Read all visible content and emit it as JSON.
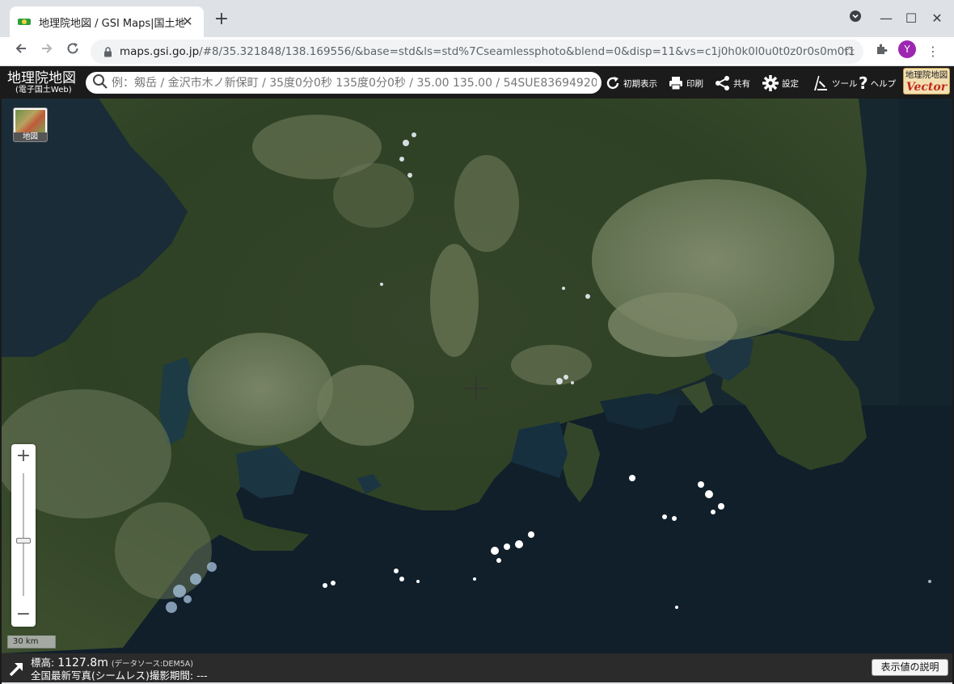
{
  "browser": {
    "tab_title": "地理院地図 / GSI Maps|国土地理院",
    "url_host": "maps.gsi.go.jp",
    "url_path": "/#8/35.321848/138.169556/&base=std&ls=std%7Cseamlessphoto&blend=0&disp=11&vs=c1j0h0k0l0u0t0z0r0s0m0f1",
    "avatar_letter": "Y"
  },
  "header": {
    "logo_main": "地理院地図",
    "logo_sub": "(電子国土Web)",
    "search_placeholder": "例：剱岳 / 金沢市木ノ新保町 / 35度0分0秒 135度0分0秒 / 35.00 135.00 / 54SUE83694920",
    "tools": [
      {
        "icon": "reload-icon",
        "label": "初期表示"
      },
      {
        "icon": "print-icon",
        "label": "印刷"
      },
      {
        "icon": "share-icon",
        "label": "共有"
      },
      {
        "icon": "gear-icon",
        "label": "設定"
      },
      {
        "icon": "tools-icon",
        "label": "ツール"
      },
      {
        "icon": "help-icon",
        "label": "ヘルプ"
      }
    ],
    "vector_badge_top": "地理院地図",
    "vector_badge_bottom": "Vector"
  },
  "map": {
    "layer_button_label": "地図",
    "scale_label": "30 km",
    "zoom_plus": "+",
    "zoom_minus": "−",
    "zoom_level": 8
  },
  "info": {
    "elevation_label": "標高:",
    "elevation_value": "1127.8m",
    "elevation_source": "(データソース:DEM5A)",
    "photo_line": "全国最新写真(シームレス)撮影期間: ---",
    "explain_button": "表示値の説明"
  },
  "colors": {
    "header_bg": "#1b1b1b",
    "infobar_bg": "#2b2b2b",
    "vector_red": "#c0281a"
  }
}
